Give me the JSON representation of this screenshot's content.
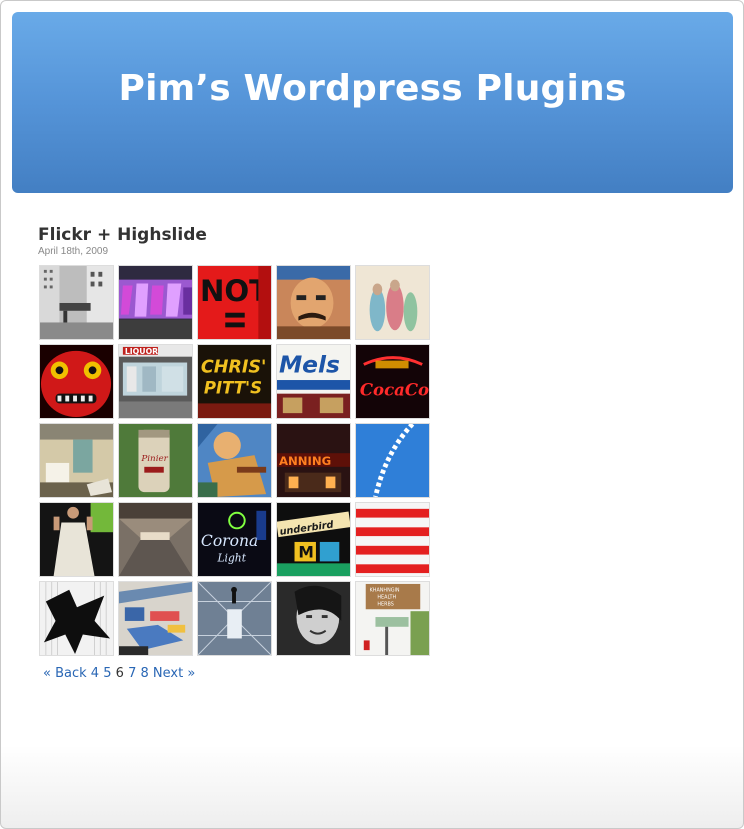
{
  "site": {
    "title": "Pim’s Wordpress Plugins"
  },
  "post": {
    "title": "Flickr + Highslide",
    "date": "April 18th, 2009"
  },
  "thumbnails": [
    {
      "alt": "city-building"
    },
    {
      "alt": "graffiti-purple"
    },
    {
      "alt": "red-sign-letters"
    },
    {
      "alt": "mural-face"
    },
    {
      "alt": "blurry-people"
    },
    {
      "alt": "red-mask"
    },
    {
      "alt": "liquor-store"
    },
    {
      "alt": "chris-pitts-sign"
    },
    {
      "alt": "mels-sign"
    },
    {
      "alt": "coca-cola-neon"
    },
    {
      "alt": "abandoned-room"
    },
    {
      "alt": "beer-can"
    },
    {
      "alt": "painted-mural"
    },
    {
      "alt": "night-diner"
    },
    {
      "alt": "blue-sky-contrail"
    },
    {
      "alt": "fashion-figure"
    },
    {
      "alt": "warehouse-hall"
    },
    {
      "alt": "corona-neon"
    },
    {
      "alt": "thunderbird-sign"
    },
    {
      "alt": "red-white-stripes"
    },
    {
      "alt": "silhouette-figure"
    },
    {
      "alt": "graffiti-wall"
    },
    {
      "alt": "glass-corridor"
    },
    {
      "alt": "smiling-woman"
    },
    {
      "alt": "health-herbs-sign"
    }
  ],
  "pagination": {
    "back": "« Back",
    "pages": [
      "4",
      "5",
      "6",
      "7",
      "8"
    ],
    "current": "6",
    "next": "Next »"
  },
  "colors": {
    "header": "#5594d8",
    "link": "#2a67b5"
  }
}
